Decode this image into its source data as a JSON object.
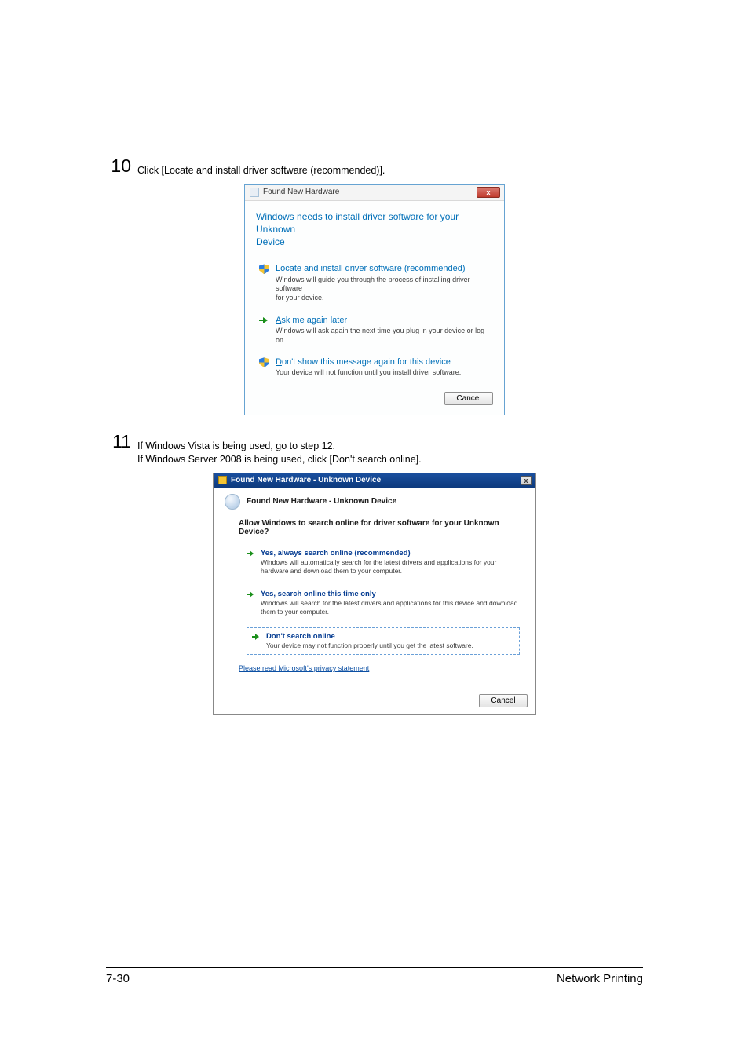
{
  "steps": {
    "s10": {
      "num": "10",
      "text": "Click [Locate and install driver software (recommended)]."
    },
    "s11": {
      "num": "11",
      "line1": "If Windows Vista is being used, go to step 12.",
      "line2": "If Windows Server 2008 is being used, click [Don't search online]."
    }
  },
  "dialog1": {
    "title": "Found New Hardware",
    "close_glyph": "x",
    "heading_l1": "Windows needs to install driver software for your Unknown",
    "heading_l2": "Device",
    "opt1": {
      "title": "Locate and install driver software (recommended)",
      "desc_l1": "Windows will guide you through the process of installing driver software",
      "desc_l2": "for your device."
    },
    "opt2": {
      "title_prefix": "A",
      "title_rest": "sk me again later",
      "desc": "Windows will ask again the next time you plug in your device or log on."
    },
    "opt3": {
      "title_prefix": "D",
      "title_rest": "on't show this message again for this device",
      "desc": "Your device will not function until you install driver software."
    },
    "cancel": "Cancel"
  },
  "dialog2": {
    "title": "Found New Hardware - Unknown Device",
    "close_glyph": "x",
    "subheader": "Found New Hardware - Unknown Device",
    "question": "Allow Windows to search online for driver software for your Unknown Device?",
    "opt1": {
      "title": "Yes, always search online (recommended)",
      "desc": "Windows will automatically search for the latest drivers and applications for your hardware and download them to your computer."
    },
    "opt2": {
      "title": "Yes, search online this time only",
      "desc": "Windows will search for the latest drivers and applications for this device and download them to your computer."
    },
    "opt3": {
      "title": "Don't search online",
      "desc": "Your device may not function properly until you get the latest software."
    },
    "link": "Please read Microsoft's  privacy statement",
    "cancel": "Cancel"
  },
  "footer": {
    "page": "7-30",
    "section": "Network Printing"
  }
}
